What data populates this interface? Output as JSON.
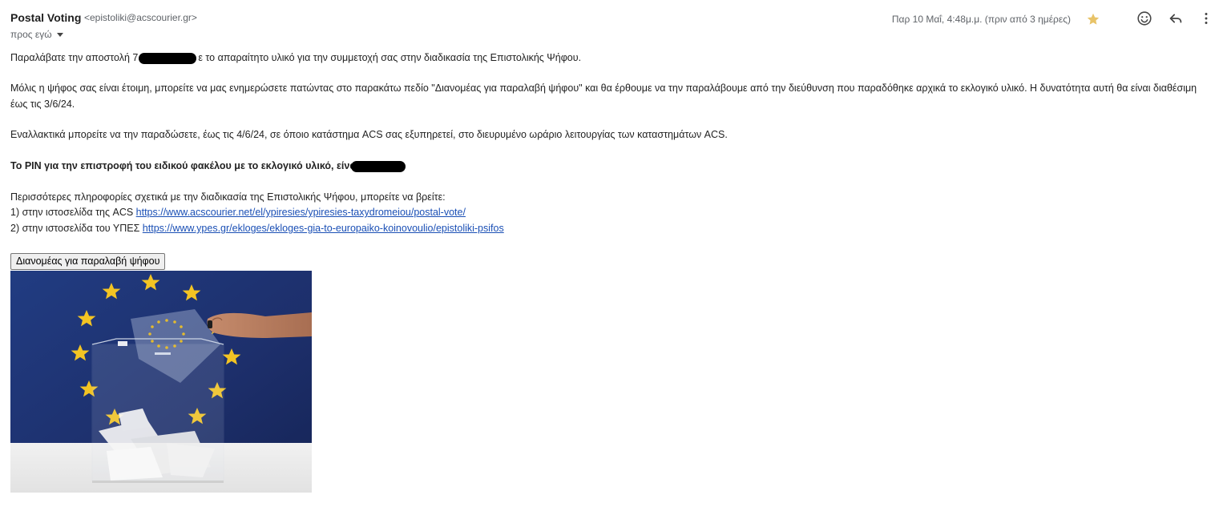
{
  "header": {
    "sender_name": "Postal Voting",
    "sender_email": "<epistoliki@acscourier.gr>",
    "recipient": "προς εγώ",
    "date": "Παρ 10 Μαΐ, 4:48μ.μ. (πριν από 3 ημέρες)",
    "icons": [
      "star-icon",
      "emoji-icon",
      "reply-icon",
      "more-vert-icon"
    ],
    "star_color": "#e8c368"
  },
  "body": {
    "p1_before": "Παραλάβατε την αποστολή 7",
    "p1_after": "ε το απαραίτητο υλικό για την συμμετοχή σας στην διαδικασία της Επιστολικής Ψήφου.",
    "p2": "Μόλις η ψήφος σας είναι έτοιμη, μπορείτε να μας ενημερώσετε πατώντας στο παρακάτω πεδίο \"Διανομέας για παραλαβή ψήφου\" και θα έρθουμε να την παραλάβουμε από την διεύθυνση που παραδόθηκε αρχικά το εκλογικό υλικό. Η δυνατότητα αυτή θα είναι διαθέσιμη έως τις 3/6/24.",
    "p3": "Εναλλακτικά μπορείτε να την παραδώσετε, έως τις 4/6/24, σε όποιο κατάστημα ACS σας εξυπηρετεί, στο διευρυμένο ωράριο λειτουργίας των καταστημάτων ACS.",
    "p4": "Το PIN για την επιστροφή του ειδικού φακέλου με το εκλογικό υλικό, είνα",
    "p5": "Περισσότερες πληροφορίες σχετικά με την διαδικασία της Επιστολικής Ψήφου, μπορείτε να βρείτε:",
    "p6_label": "1) στην ιστοσελίδα της ACS ",
    "p6_link": "https://www.acscourier.net/el/ypiresies/ypiresies-taxydromeiou/postal-vote/",
    "p7_label": "2) στην ιστοσελίδα του ΥΠΕΣ ",
    "p7_link": "https://www.ypes.gr/ekloges/ekloges-gia-to-europaiko-koinovoulio/epistoliki-psifos",
    "link_color": "#1a4fb5"
  },
  "button": {
    "label": "Διανομέας για παραλαβή ψήφου"
  },
  "image": {
    "subject": "eu-flag-ballot-box-photo",
    "flag_color": "#1d2f6b",
    "star_color": "#f3c423"
  }
}
